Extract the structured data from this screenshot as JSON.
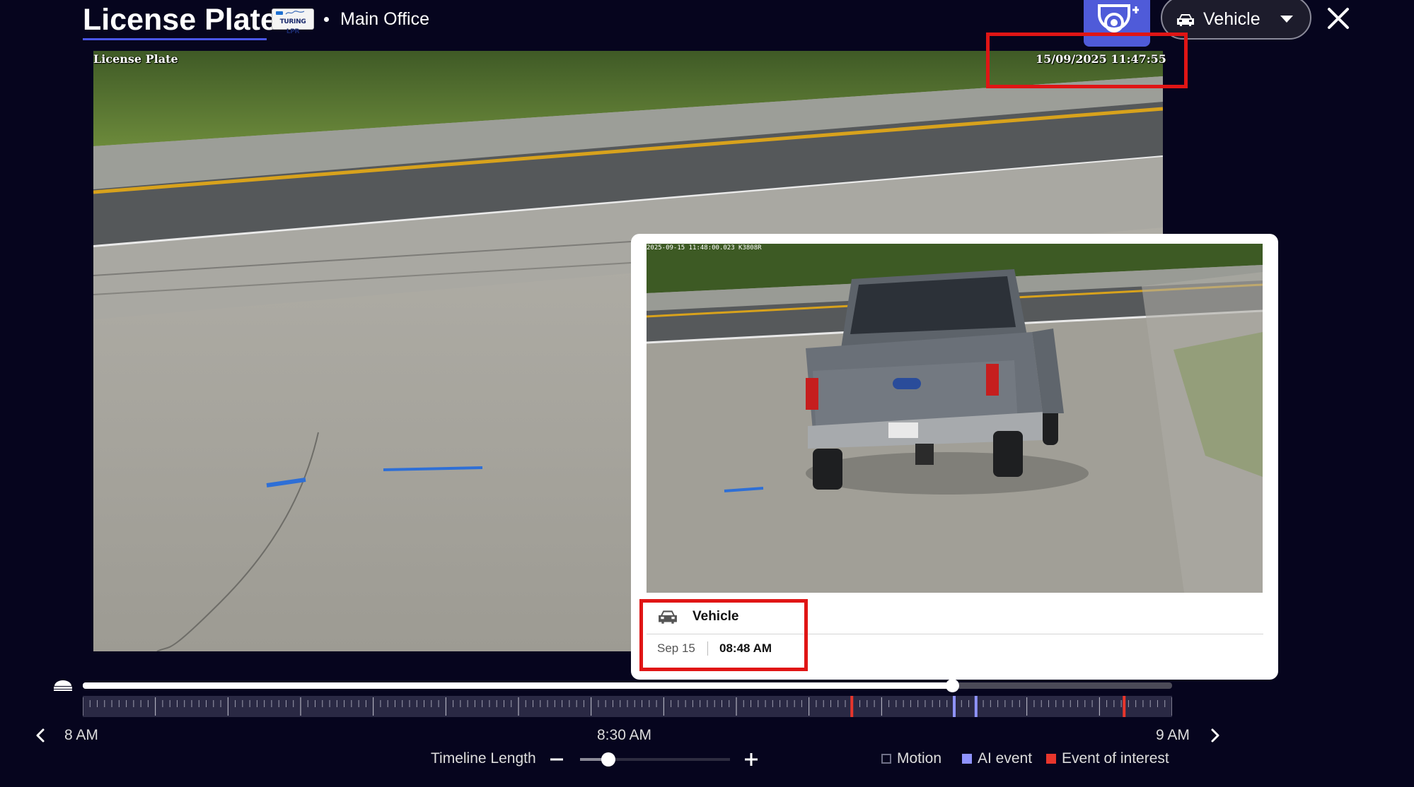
{
  "header": {
    "title": "License Plate",
    "location": "Main Office",
    "badge_text": "TURING LPR",
    "vehicle_select": "Vehicle"
  },
  "feed": {
    "osd_name": "License Plate",
    "osd_timestamp": "15/09/2025 11:47:55"
  },
  "event": {
    "type": "Vehicle",
    "date": "Sep 15",
    "time": "08:48 AM",
    "snapshot_stamp": "2025-09-15 11:48:00.023 K3808R"
  },
  "timeline": {
    "start_label": "8 AM",
    "mid_label": "8:30 AM",
    "end_label": "9 AM",
    "playhead_fraction": 0.798,
    "length_label": "Timeline Length",
    "length_fraction": 0.19,
    "ai_event_fractions": [
      0.8,
      0.82
    ],
    "interest_event_fractions": [
      0.706,
      0.956
    ]
  },
  "legend": {
    "motion": "Motion",
    "ai_event": "AI event",
    "event_of_interest": "Event of interest"
  },
  "colors": {
    "background": "#06051e",
    "accent": "#4f5bd9",
    "highlight": "#e01515",
    "motion": "#6f7087",
    "ai_event": "#8f93ff",
    "event_of_interest": "#e8362c"
  }
}
